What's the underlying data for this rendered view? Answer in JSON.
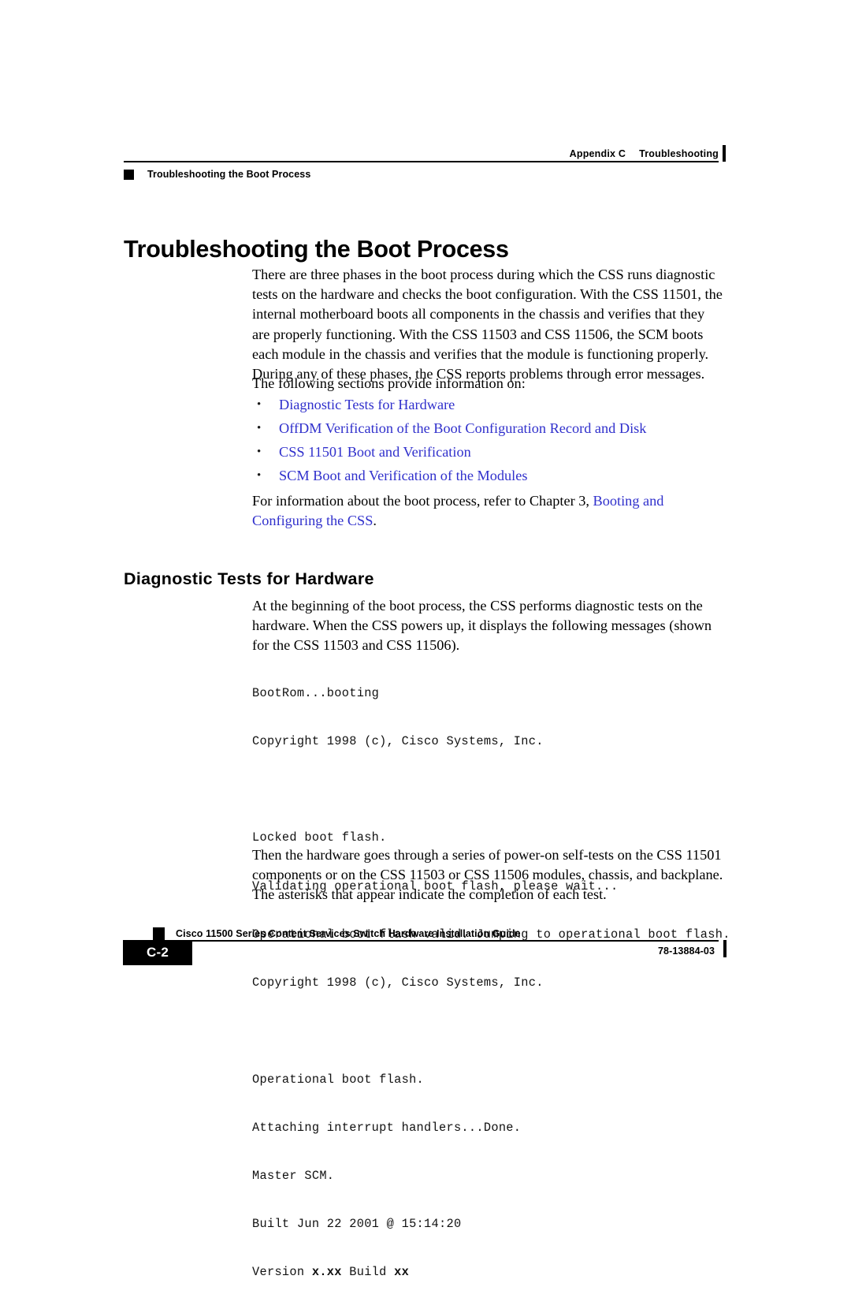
{
  "header": {
    "chapter_label": "Appendix C",
    "chapter_title": "Troubleshooting",
    "section_label": "Troubleshooting the Boot Process"
  },
  "content": {
    "h1": "Troubleshooting the Boot Process",
    "intro_paragraph": "There are three phases in the boot process during which the CSS runs diagnostic tests on the hardware and checks the boot configuration. With the CSS 11501, the internal motherboard boots all components in the chassis and verifies that they are properly functioning. With the CSS 11503 and CSS 11506, the SCM boots each module in the chassis and verifies that the module is functioning properly. During any of these phases, the CSS reports problems through error messages.",
    "sections_lead": "The following sections provide information on:",
    "bullet_marker": "•",
    "section_links": [
      "Diagnostic Tests for Hardware",
      "OffDM Verification of the Boot Configuration Record and Disk",
      "CSS 11501 Boot and Verification",
      "SCM Boot and Verification of the Modules"
    ],
    "crossref": {
      "before": "For information about the boot process, refer to Chapter 3, ",
      "link": "Booting and Configuring the CSS",
      "after": "."
    },
    "h2": "Diagnostic Tests for Hardware",
    "diagnostic_paragraph": "At the beginning of the boot process, the CSS performs diagnostic tests on the hardware. When the CSS powers up, it displays the following messages (shown for the CSS 11503 and CSS 11506).",
    "code_lines": [
      "BootRom...booting",
      "Copyright 1998 (c), Cisco Systems, Inc.",
      "",
      "Locked boot flash.",
      "Validating operational boot flash, please wait...",
      "Operational boot flash valid. Jumping to operational boot flash.",
      "Copyright 1998 (c), Cisco Systems, Inc.",
      "",
      "Operational boot flash.",
      "Attaching interrupt handlers...Done.",
      "Master SCM.",
      "Built Jun 22 2001 @ 15:14:20"
    ],
    "code_version_line": {
      "prefix": "Version ",
      "bold1": "x.xx",
      "middle": " Build ",
      "bold2": "xx"
    },
    "closing_paragraph": "Then the hardware goes through a series of power-on self-tests on the CSS 11501 components or on the CSS 11503 or CSS 11506 modules, chassis, and backplane. The asterisks that appear indicate the completion of each test."
  },
  "footer": {
    "guide_title": "Cisco 11500 Series Content Services Switch Hardware Installation Guide",
    "page_number": "C-2",
    "doc_number": "78-13884-03"
  },
  "colors": {
    "link": "#3030cc",
    "text": "#000000",
    "rule": "#000000"
  }
}
